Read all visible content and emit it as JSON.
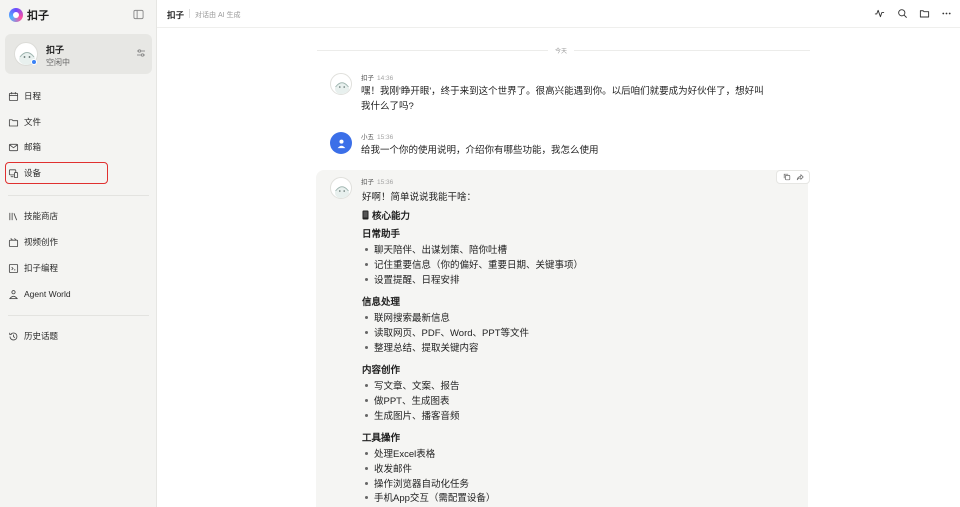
{
  "sidebar": {
    "brand": "扣子",
    "profile": {
      "name": "扣子",
      "status": "空闲中"
    },
    "nav_primary": [
      {
        "label": "日程",
        "icon": "calendar-icon"
      },
      {
        "label": "文件",
        "icon": "folder-icon"
      },
      {
        "label": "邮箱",
        "icon": "mail-icon"
      },
      {
        "label": "设备",
        "icon": "device-icon"
      }
    ],
    "nav_secondary": [
      {
        "label": "技能商店",
        "icon": "store-icon"
      },
      {
        "label": "视频创作",
        "icon": "video-icon"
      },
      {
        "label": "扣子编程",
        "icon": "code-icon"
      },
      {
        "label": "Agent World",
        "icon": "agent-world-icon"
      }
    ],
    "history": {
      "label": "历史话题",
      "icon": "history-icon"
    },
    "highlight_color": "#e0302f"
  },
  "topbar": {
    "title": "扣子",
    "subtitle": "对话由 AI 生成",
    "icons": [
      "activity-icon",
      "search-icon",
      "folder-icon",
      "more-icon"
    ]
  },
  "chat": {
    "date_label": "今天",
    "messages": [
      {
        "sender": "扣子",
        "time": "14:36",
        "lines": [
          "嘿！我刚'睁开眼'，终于来到这个世界了。很高兴能遇到你。以后咱们就要成为好伙伴了，想好叫",
          "我什么了吗?"
        ]
      },
      {
        "sender": "小五",
        "time": "15:36",
        "lines": [
          "给我一个你的使用说明，介绍你有哪些功能，我怎么使用"
        ]
      },
      {
        "sender": "扣子",
        "time": "15:36"
      }
    ],
    "reply": {
      "intro": "好啊！简单说说我能干啥：",
      "core_title": "核心能力",
      "sections": [
        {
          "title": "日常助手",
          "items": [
            "聊天陪伴、出谋划策、陪你吐槽",
            "记住重要信息（你的偏好、重要日期、关键事项）",
            "设置提醒、日程安排"
          ]
        },
        {
          "title": "信息处理",
          "items": [
            "联网搜索最新信息",
            "读取网页、PDF、Word、PPT等文件",
            "整理总结、提取关键内容"
          ]
        },
        {
          "title": "内容创作",
          "items": [
            "写文章、文案、报告",
            "做PPT、生成图表",
            "生成图片、播客音频"
          ]
        },
        {
          "title": "工具操作",
          "items": [
            "处理Excel表格",
            "收发邮件",
            "操作浏览器自动化任务",
            "手机App交互（需配置设备）"
          ]
        }
      ]
    }
  },
  "colors": {
    "accent": "#3b6fe8",
    "status": "#3b82f6"
  }
}
